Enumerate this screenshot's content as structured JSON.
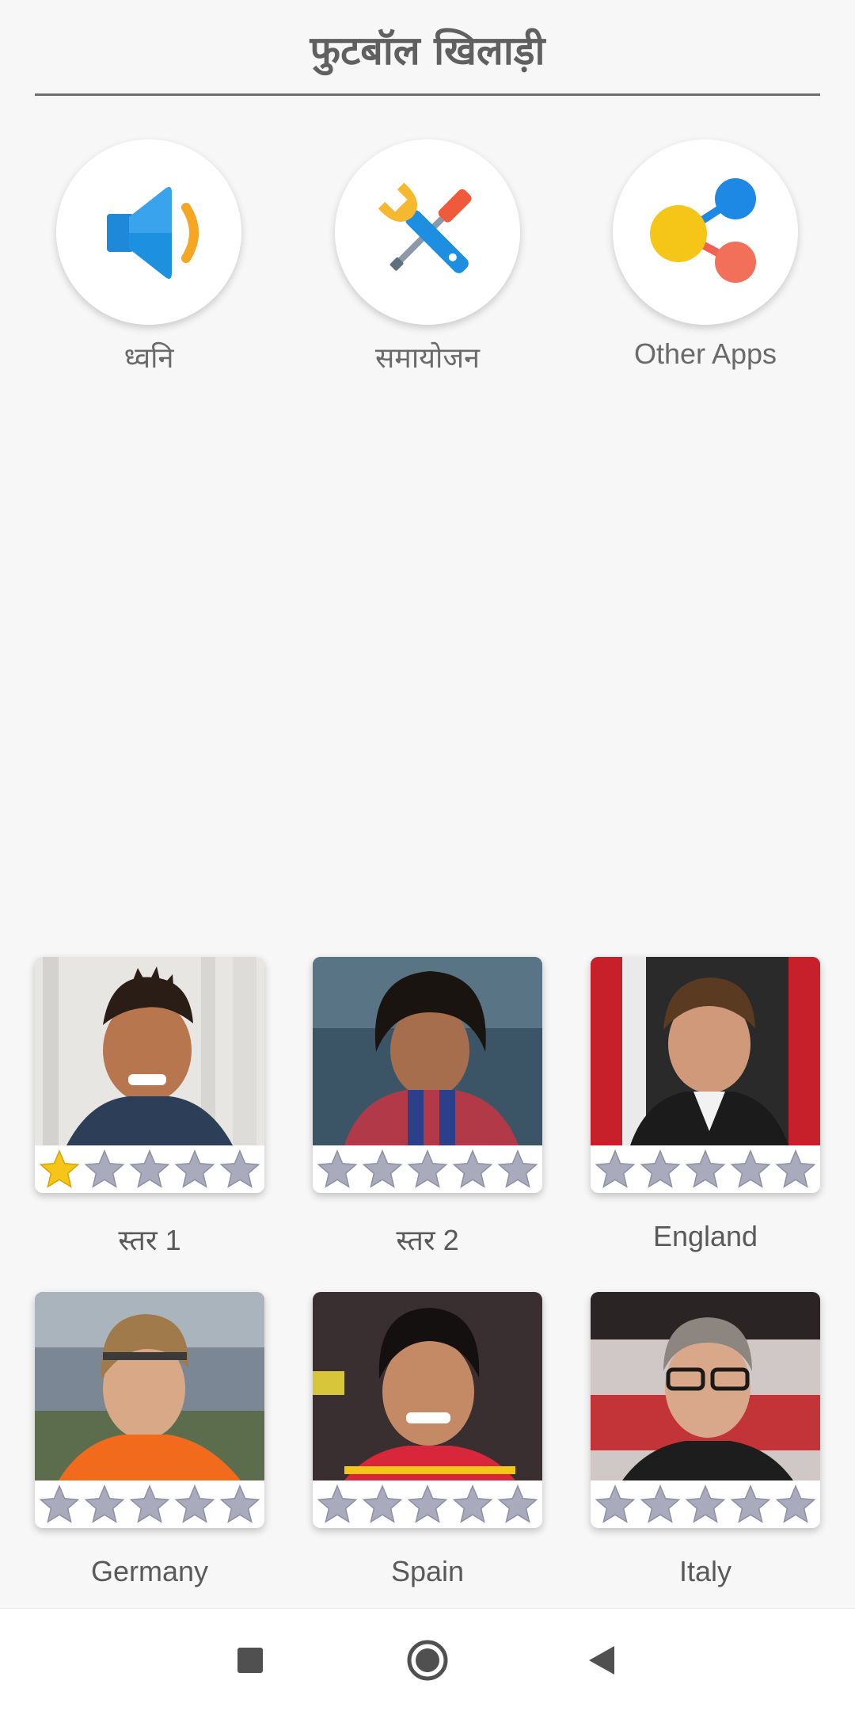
{
  "header": {
    "title": "फुटबॉल खिलाड़ी"
  },
  "top_buttons": [
    {
      "label": "ध्वनि",
      "icon": "speaker-icon"
    },
    {
      "label": "समायोजन",
      "icon": "tools-icon"
    },
    {
      "label": "Other Apps",
      "icon": "share-icon"
    }
  ],
  "levels": [
    {
      "label": "स्तर 1",
      "stars": 1,
      "max_stars": 5
    },
    {
      "label": "स्तर 2",
      "stars": 0,
      "max_stars": 5
    },
    {
      "label": "England",
      "stars": 0,
      "max_stars": 5
    },
    {
      "label": "Germany",
      "stars": 0,
      "max_stars": 5
    },
    {
      "label": "Spain",
      "stars": 0,
      "max_stars": 5
    },
    {
      "label": "Italy",
      "stars": 0,
      "max_stars": 5
    }
  ],
  "nav": {
    "icons": [
      "recents-square-icon",
      "home-circle-icon",
      "back-triangle-icon"
    ]
  },
  "colors": {
    "star_filled": "#f5c518",
    "star_empty": "#a9abbd",
    "speaker_blue": "#1f88d8",
    "accent_orange": "#f5a623"
  }
}
